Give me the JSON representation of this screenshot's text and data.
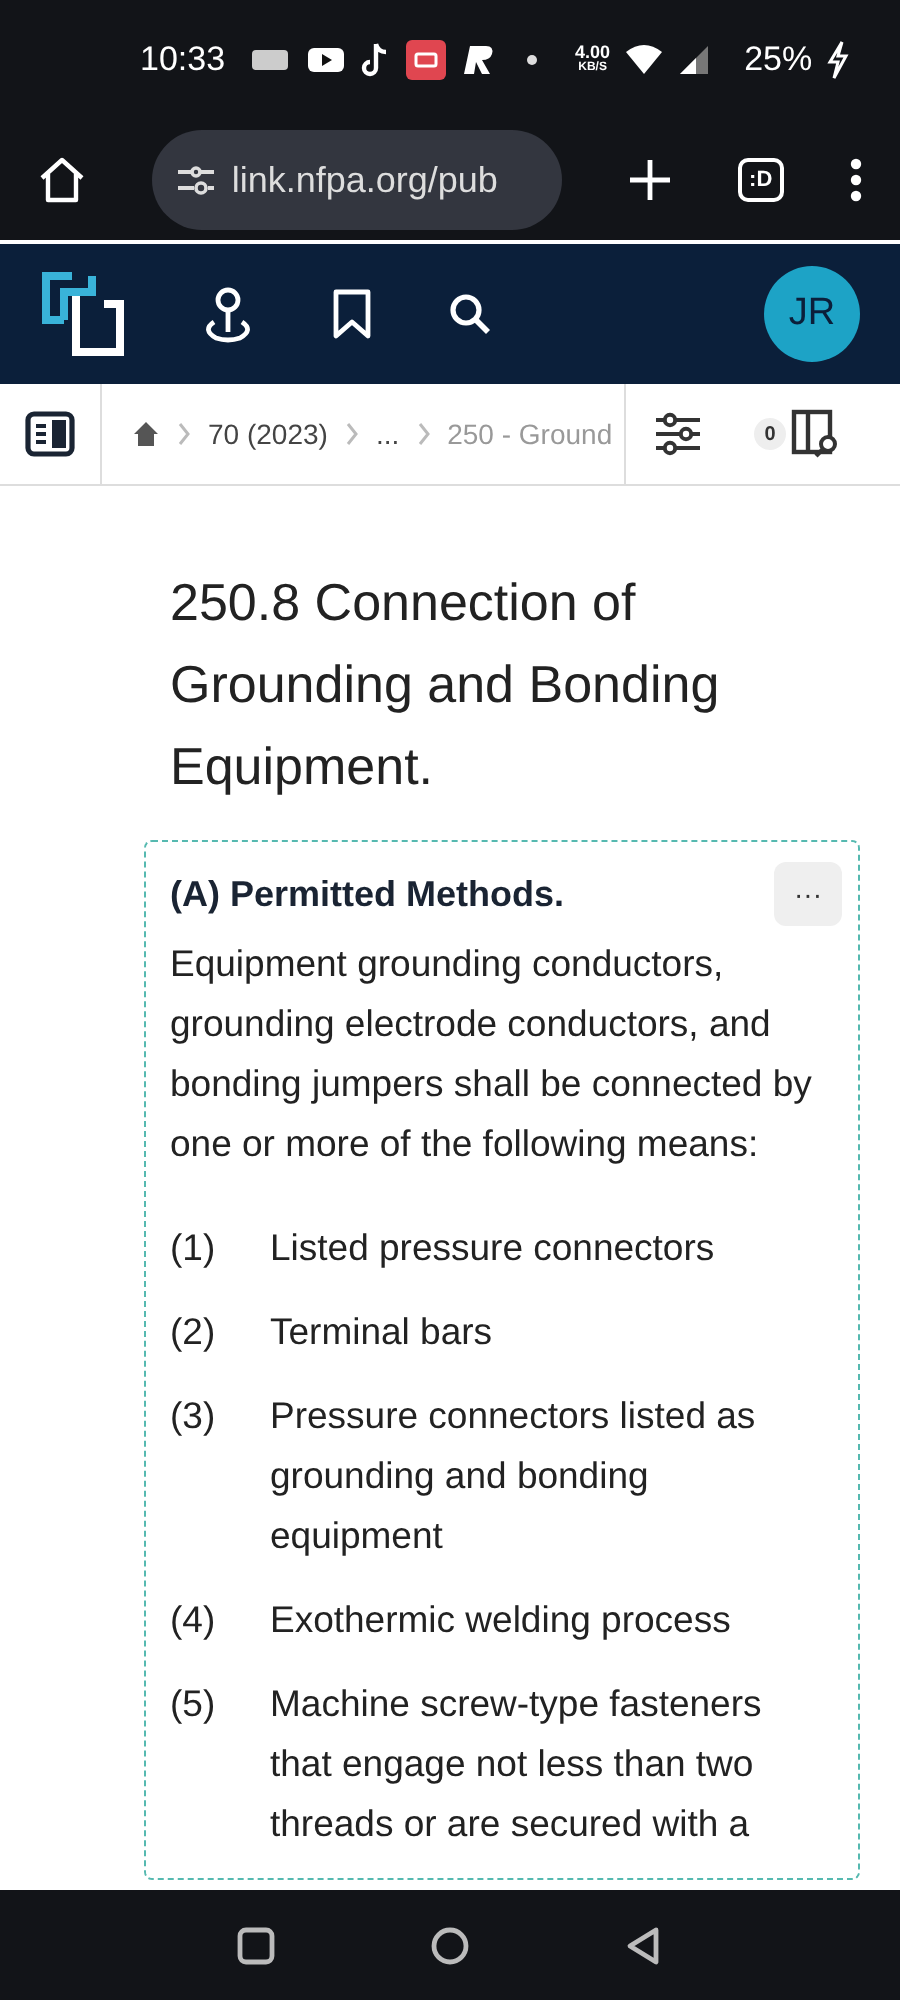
{
  "status_bar": {
    "time": "10:33",
    "net_speed": "4.00",
    "net_unit": "KB/S",
    "battery": "25%"
  },
  "browser": {
    "url": "link.nfpa.org/pub",
    "tab_label": ":D"
  },
  "app_header": {
    "avatar": "JR"
  },
  "breadcrumb": {
    "items": [
      "70 (2023)",
      "...",
      "250 - Ground"
    ],
    "badge": "0"
  },
  "section": {
    "title": "250.8 Connection of Grounding and Bonding Equipment.",
    "subsection": {
      "heading": "(A) Permitted Methods.",
      "menu": "···",
      "intro": "Equipment grounding conductors, grounding electrode conductors, and bonding jumpers shall be connected by one or more of the following means:",
      "items": [
        {
          "num": "(1)",
          "text": "Listed pressure connectors"
        },
        {
          "num": "(2)",
          "text": "Terminal bars"
        },
        {
          "num": "(3)",
          "text": "Pressure connectors listed as grounding and bonding equipment"
        },
        {
          "num": "(4)",
          "text": "Exothermic welding process"
        },
        {
          "num": "(5)",
          "text": "Machine screw-type fasteners that engage not less than two threads or are secured with a"
        }
      ]
    }
  }
}
